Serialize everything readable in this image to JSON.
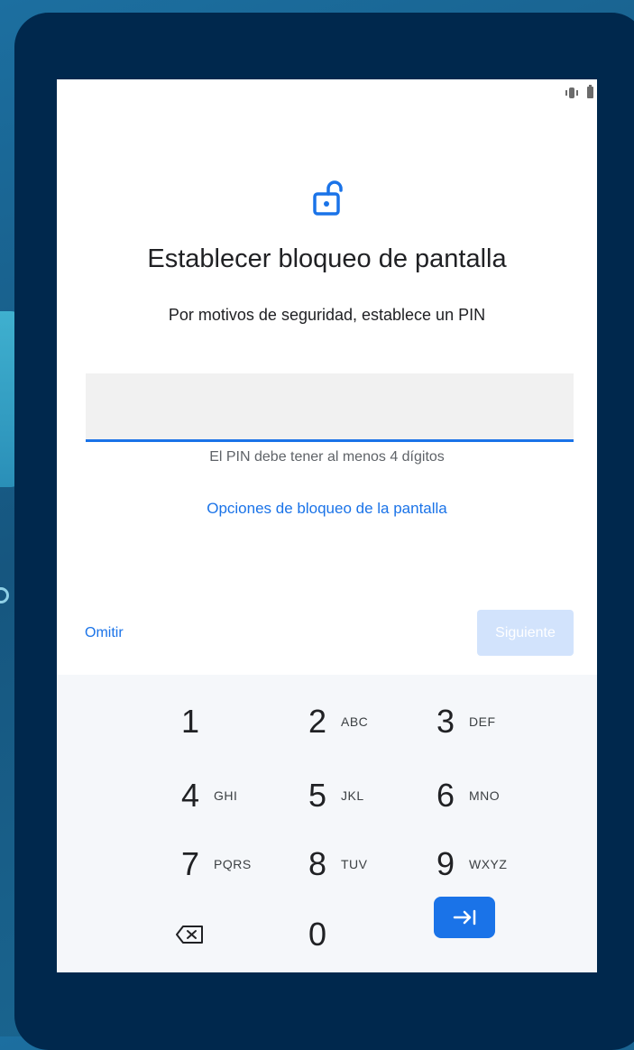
{
  "screen": {
    "title": "Establecer bloqueo de pantalla",
    "subtitle": "Por motivos de seguridad, establece un PIN",
    "pin_value": "",
    "helper": "El PIN debe tener al menos 4 dígitos",
    "options_link": "Opciones de bloqueo de la pantalla",
    "skip_label": "Omitir",
    "next_label": "Siguiente"
  },
  "keypad": {
    "keys": [
      {
        "digit": "1",
        "letters": ""
      },
      {
        "digit": "2",
        "letters": "ABC"
      },
      {
        "digit": "3",
        "letters": "DEF"
      },
      {
        "digit": "4",
        "letters": "GHI"
      },
      {
        "digit": "5",
        "letters": "JKL"
      },
      {
        "digit": "6",
        "letters": "MNO"
      },
      {
        "digit": "7",
        "letters": "PQRS"
      },
      {
        "digit": "8",
        "letters": "TUV"
      },
      {
        "digit": "9",
        "letters": "WXYZ"
      },
      {
        "digit": "0",
        "letters": ""
      }
    ],
    "backspace_icon": "backspace-icon",
    "enter_icon": "tab-arrow-icon"
  },
  "icons": {
    "lock": "lock-open-icon",
    "vibrate": "vibrate-icon",
    "battery": "battery-icon"
  },
  "colors": {
    "accent": "#1a73e8",
    "next_disabled": "#d2e3fc",
    "device_frame": "#00284d"
  }
}
